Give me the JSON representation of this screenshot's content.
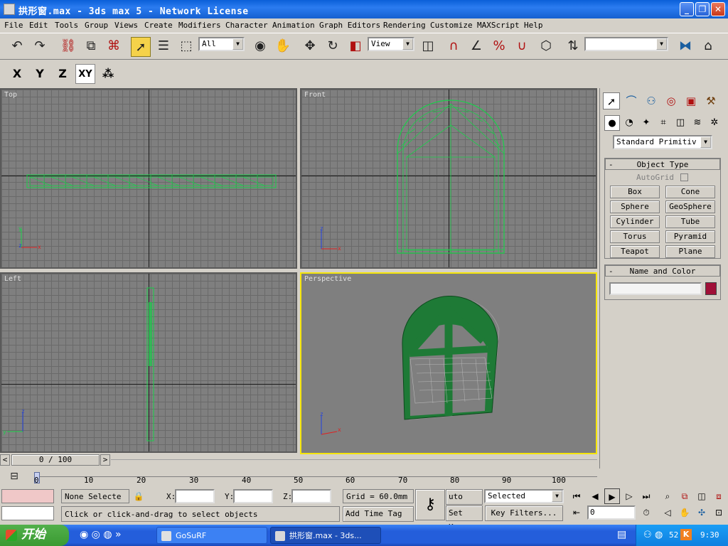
{
  "window": {
    "title": "拱形窗.max - 3ds max 5 - Network License",
    "min_label": "_",
    "max_label": "❐",
    "close_label": "✕"
  },
  "menu": [
    "File",
    "Edit",
    "Tools",
    "Group",
    "Views",
    "Create",
    "Modifiers",
    "Character",
    "Animation",
    "Graph Editors",
    "Rendering",
    "Customize",
    "MAXScript",
    "Help"
  ],
  "toolbar": {
    "selection_filter": "All",
    "ref_coord": "View",
    "named_selection": ""
  },
  "axis_constraints": [
    "X",
    "Y",
    "Z",
    "XY"
  ],
  "viewports": {
    "top": "Top",
    "front": "Front",
    "left": "Left",
    "perspective": "Perspective"
  },
  "command_panel": {
    "category": "Standard Primitiv",
    "object_type_title": "Object Type",
    "autogrid": "AutoGrid",
    "buttons": [
      "Box",
      "Cone",
      "Sphere",
      "GeoSphere",
      "Cylinder",
      "Tube",
      "Torus",
      "Pyramid",
      "Teapot",
      "Plane"
    ],
    "name_color_title": "Name and Color",
    "name_value": "",
    "color": "#a01038",
    "collapse_sign": "-"
  },
  "timeline": {
    "frame_display": "0 / 100",
    "ticks": [
      "0",
      "10",
      "20",
      "30",
      "40",
      "50",
      "60",
      "70",
      "80",
      "90",
      "100"
    ]
  },
  "status": {
    "selection": "None Selecte",
    "x_label": "X:",
    "y_label": "Y:",
    "z_label": "Z:",
    "grid": "Grid = 60.0mm",
    "prompt": "Click or click-and-drag to select objects",
    "add_time_tag": "Add Time Tag",
    "auto_key": "uto Key",
    "set_key": "Set Key",
    "key_mode": "Selected",
    "key_filters": "Key Filters...",
    "current_frame": "0"
  },
  "taskbar": {
    "start": "开始",
    "items": [
      "GoSuRF",
      "拱形窗.max - 3ds..."
    ],
    "tray_number": "52",
    "clock": "9:30"
  }
}
